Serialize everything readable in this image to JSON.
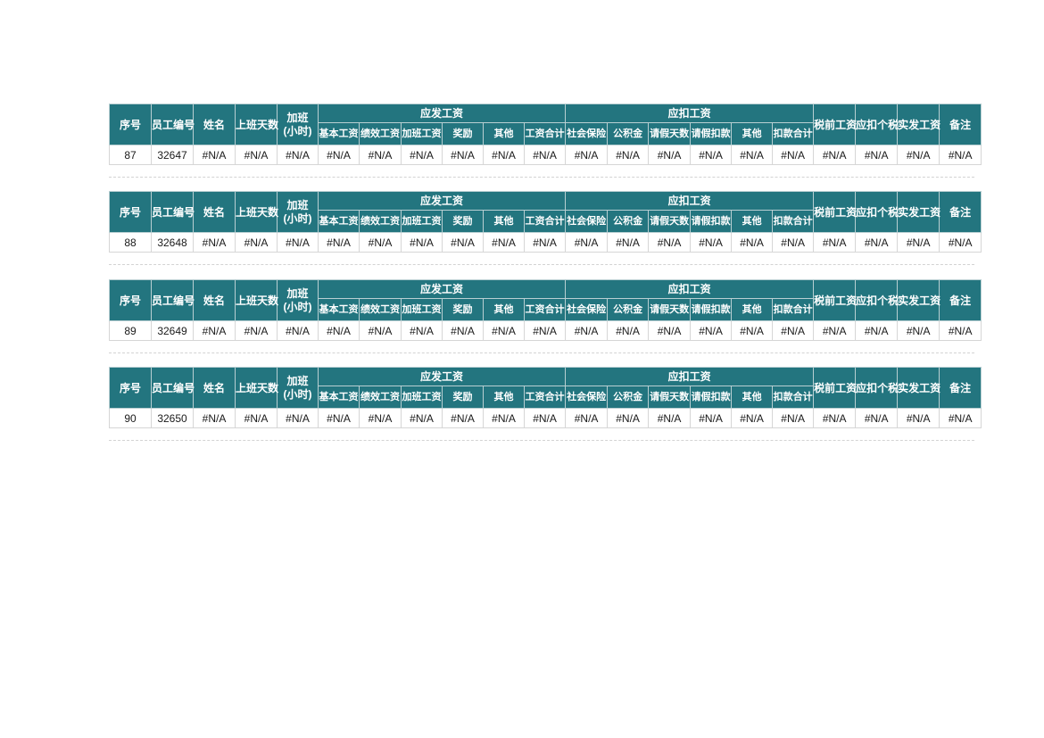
{
  "document": {
    "type": "spreadsheet-payroll-table",
    "header_bg_color": "#23757f",
    "header_text_color": "#ffffff",
    "cell_border_color": "#d6d6d6",
    "separator_color": "#d3d3d3"
  },
  "columns": {
    "seq": "序号",
    "employee_id": "员工编号",
    "name": "姓名",
    "work_days": "上班天数",
    "overtime": "加班\n(小时)",
    "overtime_line1": "加班",
    "overtime_line2": "(小时)",
    "payable_group": "应发工资",
    "payable_sub": [
      "基本工资",
      "绩效工资",
      "加班工资",
      "奖励",
      "其他",
      "工资合计"
    ],
    "deduct_group": "应扣工资",
    "deduct_sub": [
      "社会保险",
      "公积金",
      "请假天数",
      "请假扣款",
      "其他",
      "扣款合计"
    ],
    "pretax": "税前工资",
    "income_tax": "应扣个税",
    "net_pay": "实发工资",
    "remark": "备注"
  },
  "blocks": [
    {
      "row": {
        "seq": "87",
        "employee_id": "32647",
        "name": "#N/A",
        "work_days": "#N/A",
        "overtime": "#N/A",
        "payable": [
          "#N/A",
          "#N/A",
          "#N/A",
          "#N/A",
          "#N/A",
          "#N/A"
        ],
        "deduct": [
          "#N/A",
          "#N/A",
          "#N/A",
          "#N/A",
          "#N/A",
          "#N/A"
        ],
        "pretax": "#N/A",
        "income_tax": "#N/A",
        "net_pay": "#N/A",
        "remark": "#N/A"
      }
    },
    {
      "row": {
        "seq": "88",
        "employee_id": "32648",
        "name": "#N/A",
        "work_days": "#N/A",
        "overtime": "#N/A",
        "payable": [
          "#N/A",
          "#N/A",
          "#N/A",
          "#N/A",
          "#N/A",
          "#N/A"
        ],
        "deduct": [
          "#N/A",
          "#N/A",
          "#N/A",
          "#N/A",
          "#N/A",
          "#N/A"
        ],
        "pretax": "#N/A",
        "income_tax": "#N/A",
        "net_pay": "#N/A",
        "remark": "#N/A"
      }
    },
    {
      "row": {
        "seq": "89",
        "employee_id": "32649",
        "name": "#N/A",
        "work_days": "#N/A",
        "overtime": "#N/A",
        "payable": [
          "#N/A",
          "#N/A",
          "#N/A",
          "#N/A",
          "#N/A",
          "#N/A"
        ],
        "deduct": [
          "#N/A",
          "#N/A",
          "#N/A",
          "#N/A",
          "#N/A",
          "#N/A"
        ],
        "pretax": "#N/A",
        "income_tax": "#N/A",
        "net_pay": "#N/A",
        "remark": "#N/A"
      }
    },
    {
      "row": {
        "seq": "90",
        "employee_id": "32650",
        "name": "#N/A",
        "work_days": "#N/A",
        "overtime": "#N/A",
        "payable": [
          "#N/A",
          "#N/A",
          "#N/A",
          "#N/A",
          "#N/A",
          "#N/A"
        ],
        "deduct": [
          "#N/A",
          "#N/A",
          "#N/A",
          "#N/A",
          "#N/A",
          "#N/A"
        ],
        "pretax": "#N/A",
        "income_tax": "#N/A",
        "net_pay": "#N/A",
        "remark": "#N/A"
      }
    }
  ]
}
